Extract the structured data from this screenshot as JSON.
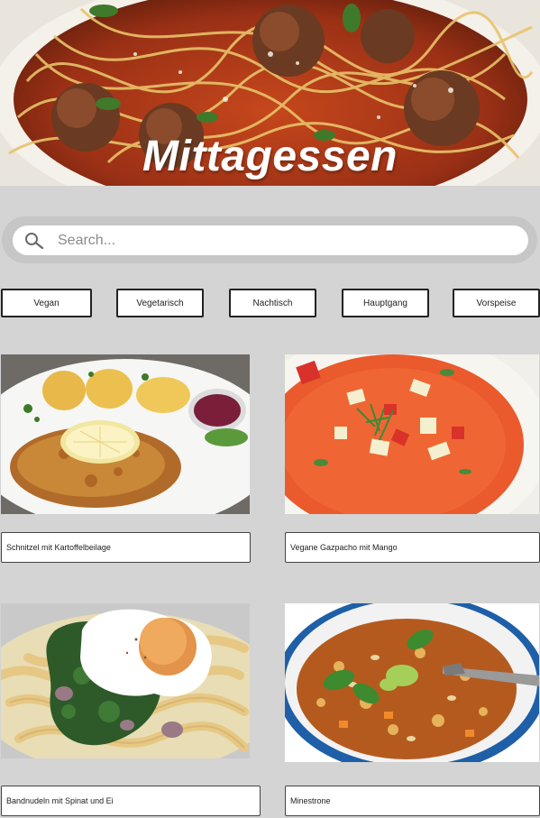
{
  "hero": {
    "title": "Mittagessen",
    "image_icon": "spaghetti-meatballs-photo"
  },
  "search": {
    "placeholder": "Search...",
    "icon": "search-icon"
  },
  "filters": [
    {
      "label": "Vegan"
    },
    {
      "label": "Vegetarisch"
    },
    {
      "label": "Nachtisch"
    },
    {
      "label": "Hauptgang"
    },
    {
      "label": "Vorspeise"
    }
  ],
  "recipes": [
    {
      "title": "Schnitzel mit Kartoffelbeilage",
      "image_icon": "schnitzel-photo"
    },
    {
      "title": "Vegane Gazpacho mit Mango",
      "image_icon": "gazpacho-photo"
    },
    {
      "title": "Bandnudeln mit Spinat und Ei",
      "image_icon": "noodles-spinach-egg-photo"
    },
    {
      "title": "Minestrone",
      "image_icon": "minestrone-photo"
    }
  ],
  "colors": {
    "page_background": "#d4d4d4",
    "search_track": "#c6c6c6",
    "button_border": "#222222"
  }
}
